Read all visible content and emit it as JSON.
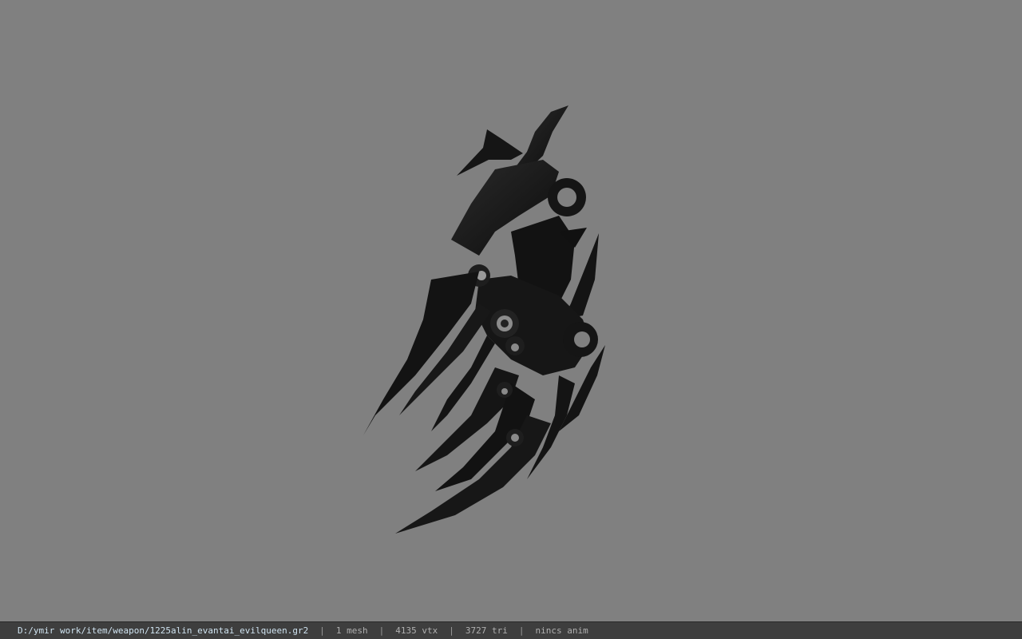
{
  "status_bar": {
    "file_path": "D:/ymir work/item/weapon/1225alin_evantai_evilqueen.gr2",
    "separator": "|",
    "mesh_count": "1 mesh",
    "vertex_count": "4135 vtx",
    "triangle_count": "3727 tri",
    "anim": "nincs anim"
  },
  "colors": {
    "viewport_background": "#808080",
    "model": "#1a1a1a",
    "status_bar_background": "#3e3e3e"
  }
}
